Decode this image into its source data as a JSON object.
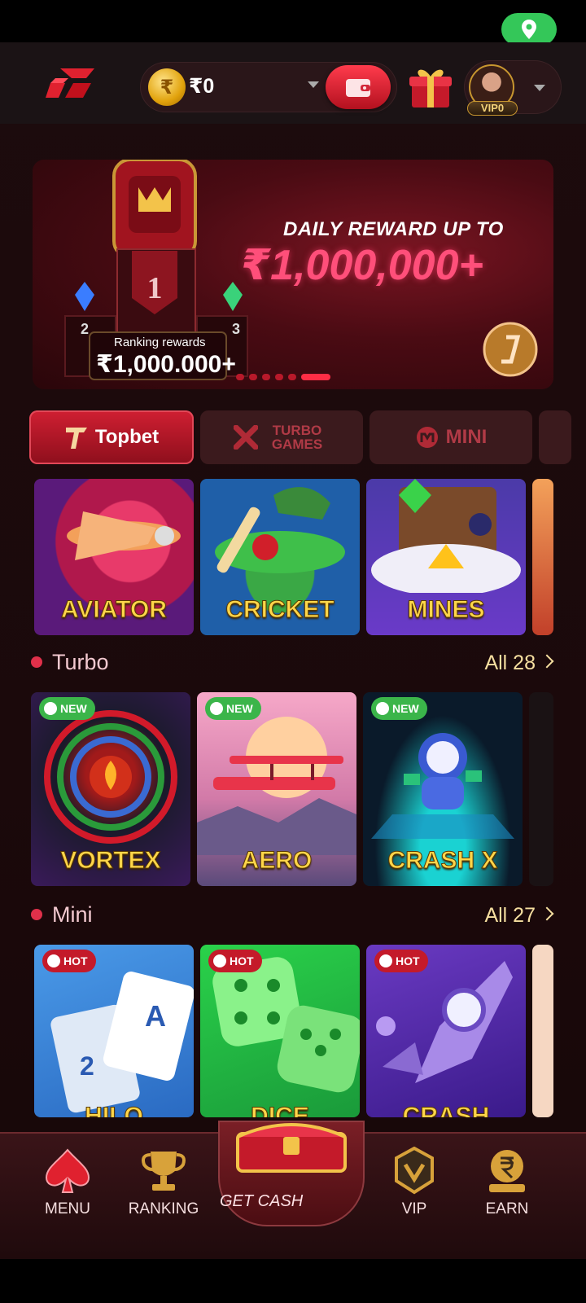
{
  "header": {
    "currency_symbol": "₹",
    "balance": "₹0",
    "vip_label": "VIP0"
  },
  "banner": {
    "line1": "DAILY REWARD UP TO",
    "line2": "₹1,000,000+",
    "podium_first": "1",
    "podium_second": "2",
    "podium_third": "3",
    "ranking_label": "Ranking rewards",
    "ranking_value": "₹1,000.000+"
  },
  "provider_tabs": [
    {
      "label": "Topbet",
      "active": true
    },
    {
      "label": "TURBO GAMES",
      "active": false
    },
    {
      "label": "MINI",
      "active": false
    }
  ],
  "featured_games": [
    {
      "title": "AVIATOR"
    },
    {
      "title": "CRICKET"
    },
    {
      "title": "MINES"
    }
  ],
  "turbo": {
    "title": "Turbo",
    "all_label": "All 28",
    "games": [
      {
        "title": "VORTEX",
        "tag": "NEW"
      },
      {
        "title": "AERO",
        "tag": "NEW"
      },
      {
        "title": "CRASH X",
        "tag": "NEW"
      }
    ]
  },
  "mini": {
    "title": "Mini",
    "all_label": "All 27",
    "games": [
      {
        "title": "HILO",
        "tag": "HOT"
      },
      {
        "title": "DICE",
        "tag": "HOT"
      },
      {
        "title": "CRASH",
        "tag": "HOT"
      }
    ]
  },
  "nav": {
    "menu": "MENU",
    "ranking": "RANKING",
    "get_cash": "GET CASH",
    "vip": "VIP",
    "earn": "EARN"
  },
  "icons": [
    "location-icon",
    "logo-icon",
    "coin-icon",
    "wallet-icon",
    "gift-icon",
    "chevron-down-icon",
    "spade-icon",
    "trophy-icon",
    "chest-icon",
    "vip-icon",
    "rupee-icon"
  ],
  "colors": {
    "accent_red": "#d01f32",
    "gold": "#ffd64a",
    "new_green": "#3bb54a",
    "hot_red": "#c41a2a"
  }
}
